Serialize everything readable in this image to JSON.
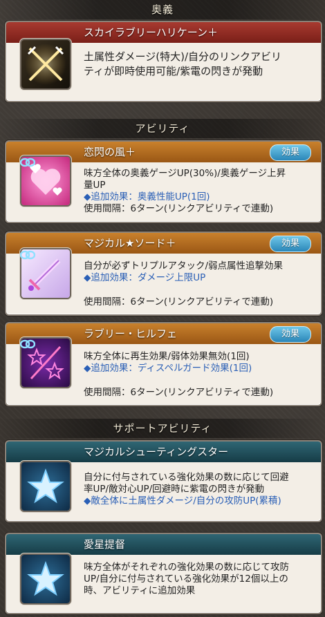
{
  "sections": {
    "ougi": "奥義",
    "ability": "アビリティ",
    "support": "サポートアビリティ"
  },
  "ougi": {
    "name": "スカイラブリーハリケーン＋",
    "desc1": "土属性ダメージ(特大)/自分のリンクアビリ",
    "desc2": "ティが即時使用可能/紫電の閃きが発動"
  },
  "abilities": [
    {
      "name": "恋閃の風＋",
      "button": "効果",
      "lines": [
        "味方全体の奥義ゲージUP(30%)/奥義ゲージ上昇",
        "量UP"
      ],
      "extra": "◆追加効果：奥義性能UP(1回)",
      "interval": "使用間隔：6ターン(リンクアビリティで連動)"
    },
    {
      "name": "マジカル★ソード＋",
      "button": "効果",
      "lines": [
        "自分が必ずトリプルアタック/弱点属性追撃効果"
      ],
      "extra": "◆追加効果：ダメージ上限UP",
      "interval": "使用間隔：6ターン(リンクアビリティで連動)"
    },
    {
      "name": "ラブリー・ヒルフェ",
      "button": "効果",
      "lines": [
        "味方全体に再生効果/弱体効果無効(1回)"
      ],
      "extra": "◆追加効果：ディスペルガード効果(1回)",
      "interval": "使用間隔：6ターン(リンクアビリティで連動)"
    }
  ],
  "supports": [
    {
      "name": "マジカルシューティングスター",
      "lines": [
        "自分に付与されている強化効果の数に応じて回避",
        "率UP/敵対心UP/回避時に紫電の閃きが発動"
      ],
      "extra": "◆敵全体に土属性ダメージ/自分の攻防UP(累積)"
    },
    {
      "name": "愛星提督",
      "lines": [
        "味方全体がそれぞれの強化効果の数に応じて攻防",
        "UP/自分に付与されている強化効果が12個以上の",
        "時、アビリティに追加効果"
      ]
    }
  ],
  "icons": {
    "ougi": "crossed-swords-icon",
    "ability1": "pink-hearts-icon",
    "ability2": "magic-sword-icon",
    "ability3": "star-wand-icon",
    "support": "blue-star-icon",
    "link": "chain-link-icon"
  },
  "colors": {
    "ougi_header": "#a83a30",
    "ability_header": "#c9812c",
    "support_header": "#2f6674",
    "effect_button": "#3a9acb",
    "extra_text": "#2a5fb6"
  }
}
